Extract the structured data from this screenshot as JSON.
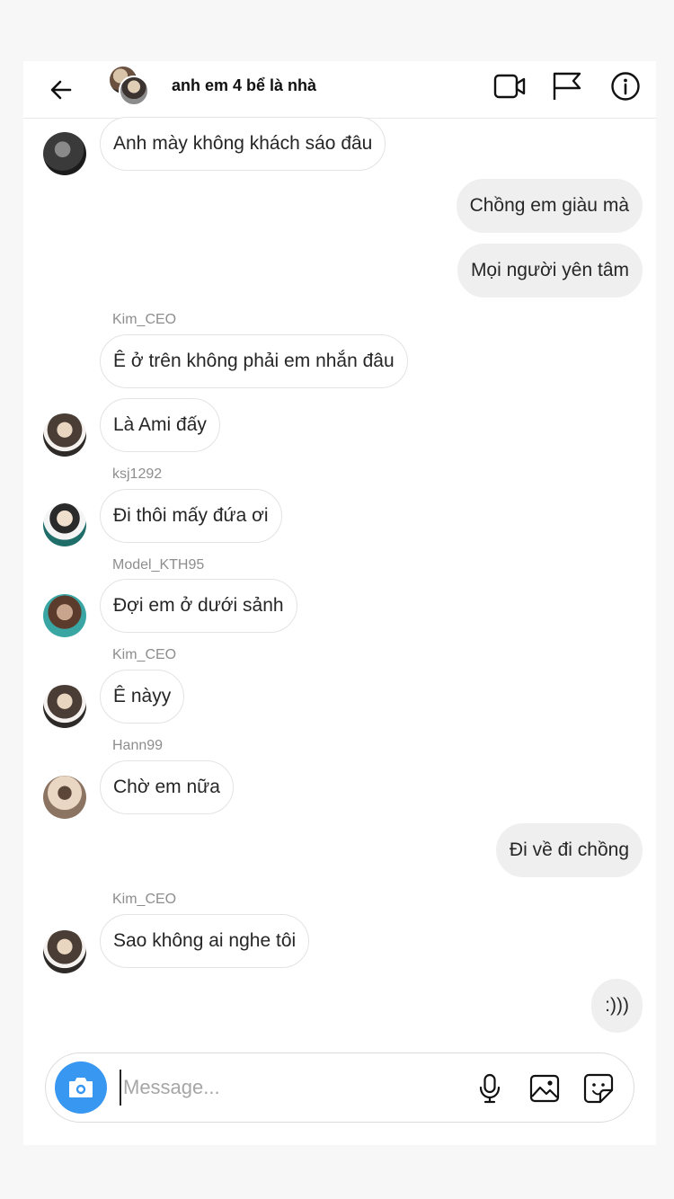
{
  "header": {
    "title": "anh em 4 bể là nhà",
    "icons": [
      "back-arrow-icon",
      "video-call-icon",
      "flag-icon",
      "info-icon"
    ]
  },
  "messages": [
    {
      "side": "in",
      "text": "Anh mày không khách sáo đâu"
    },
    {
      "side": "out",
      "text": "Chồng em giàu mà"
    },
    {
      "side": "out",
      "text": "Mọi người yên tâm"
    },
    {
      "side": "in",
      "sender": "Kim_CEO",
      "text": "Ê ở trên không phải em nhắn đâu"
    },
    {
      "side": "in",
      "text": "Là Ami đấy"
    },
    {
      "side": "in",
      "sender": "ksj1292",
      "text": "Đi thôi mấy đứa ơi"
    },
    {
      "side": "in",
      "sender": "Model_KTH95",
      "text": "Đợi em ở dưới sảnh"
    },
    {
      "side": "in",
      "sender": "Kim_CEO",
      "text": "Ê nàyy"
    },
    {
      "side": "in",
      "sender": "Hann99",
      "text": "Chờ em nữa"
    },
    {
      "side": "out",
      "text": "Đi về đi chồng"
    },
    {
      "side": "in",
      "sender": "Kim_CEO",
      "text": "Sao không ai nghe tôi"
    },
    {
      "side": "out",
      "text": ":)))"
    }
  ],
  "composer": {
    "placeholder": "Message...",
    "icons": [
      "camera-icon",
      "microphone-icon",
      "gallery-icon",
      "sticker-icon"
    ]
  },
  "colors": {
    "camera_button": "#3897f0",
    "outgoing_bubble": "#efefef",
    "incoming_bubble_border": "#e3e3e3",
    "sender_name": "#8e8e8e"
  }
}
